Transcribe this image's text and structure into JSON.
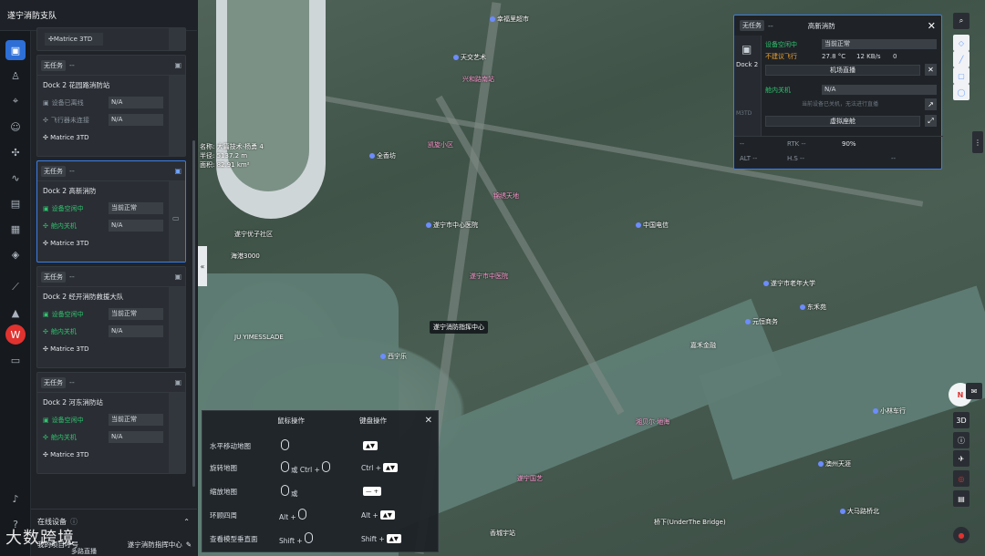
{
  "header": {
    "title": "遂宁消防支队"
  },
  "devices": [
    {
      "badge": "",
      "dash": "",
      "dock_name": "",
      "drone": "Matrice 3TD",
      "partial": true
    },
    {
      "badge": "无任务",
      "dash": "--",
      "dock_name": "Dock 2 花园路消防站",
      "dock_status_label": "设备已离线",
      "dock_status": "N/A",
      "drone_status_label": "飞行器未连接",
      "drone_status": "N/A",
      "drone": "Matrice 3TD"
    },
    {
      "badge": "无任务",
      "dash": "--",
      "dock_name": "Dock 2 高新消防",
      "dock_status_label": "设备空闲中",
      "dock_status": "当前正常",
      "drone_status_label": "舱内关机",
      "drone_status": "N/A",
      "drone": "Matrice 3TD"
    },
    {
      "badge": "无任务",
      "dash": "--",
      "dock_name": "Dock 2 经开消防救援大队",
      "dock_status_label": "设备空闲中",
      "dock_status": "当前正常",
      "drone_status_label": "舱内关机",
      "drone_status": "N/A",
      "drone": "Matrice 3TD"
    },
    {
      "badge": "无任务",
      "dash": "--",
      "dock_name": "Dock 2 河东消防站",
      "dock_status_label": "设备空闲中",
      "dock_status": "当前正常",
      "drone_status_label": "舱内关机",
      "drone_status": "N/A",
      "drone": "Matrice 3TD"
    }
  ],
  "online": {
    "title": "在线设备",
    "project_label": "我的项目呼号",
    "project_value": "遂宁消防指挥中心"
  },
  "map": {
    "tooltip": "遂宁消防指挥中心",
    "area_info": [
      "名称: 大篇技术-杨勇 4",
      "半径: 5137.2 m",
      "面积: 82.91 km²"
    ],
    "labels": [
      {
        "t": "幸福里超市"
      },
      {
        "t": "天交艺术"
      },
      {
        "t": "兴和路南站",
        "pink": true
      },
      {
        "t": "凯旋小区"
      },
      {
        "t": "全香坊"
      },
      {
        "t": "锦绣天地",
        "pink": true
      },
      {
        "t": "遂宁市中心医院"
      },
      {
        "t": "遂宁市中医院",
        "pink": true
      },
      {
        "t": "遂宁优子社区"
      },
      {
        "t": "海港3000"
      },
      {
        "t": "JU YIMESSLADE"
      },
      {
        "t": "中国电信"
      },
      {
        "t": "遂宁市老年大学"
      },
      {
        "t": "元恒商务"
      },
      {
        "t": "东禾苑"
      },
      {
        "t": "嘉禾金融"
      },
      {
        "t": "湘贝尔·地海"
      },
      {
        "t": "遂宁国艺"
      },
      {
        "t": "桥下(UnderThe Bridge)"
      },
      {
        "t": "大马路桥北"
      },
      {
        "t": "小林车行"
      },
      {
        "t": "澳州天涯"
      },
      {
        "t": "香城宇站"
      },
      {
        "t": "西宁乐"
      }
    ]
  },
  "dock": {
    "badge": "无任务",
    "dash": "--",
    "title": "高新消防",
    "model": "Dock 2",
    "drone_model": "M3TD",
    "status_label": "设备空闲中",
    "status_value": "当前正常",
    "weather_label": "不建议飞行",
    "temp": "27.8 °C",
    "net": "12 KB/s",
    "cnt": "0",
    "btn_live": "机场直播",
    "drone_label": "舱内关机",
    "drone_value": "N/A",
    "hint": "当前设备已关机，无法进行直播",
    "btn_cockpit": "虚拟座舱",
    "bottom": {
      "sig": "-- ",
      "rtk": "RTK --",
      "battery": "90%",
      "alt": "ALT --",
      "hs": "H.S --",
      "vs": "--"
    }
  },
  "right_tools": {
    "three_d": "3D",
    "north": "N",
    "scale": "000"
  },
  "help": {
    "col1": "鼠标操作",
    "col2": "键盘操作",
    "rows": [
      {
        "label": "水平移动地图",
        "m": "",
        "k": ""
      },
      {
        "label": "旋转地图",
        "m": "或 Ctrl +",
        "k": "Ctrl +"
      },
      {
        "label": "缩放地图",
        "m": "或",
        "k": "— +"
      },
      {
        "label": "环顾四周",
        "m": "Alt +",
        "k": "Alt +"
      },
      {
        "label": "查看模型垂直面",
        "m": "Shift +",
        "k": "Shift +"
      }
    ],
    "keys": {
      "ctrl": "Ctrl",
      "alt": "Alt",
      "shift": "Shift"
    }
  },
  "watermark": "大数跨境",
  "bottom_bar": {
    "live": "多路直播"
  }
}
